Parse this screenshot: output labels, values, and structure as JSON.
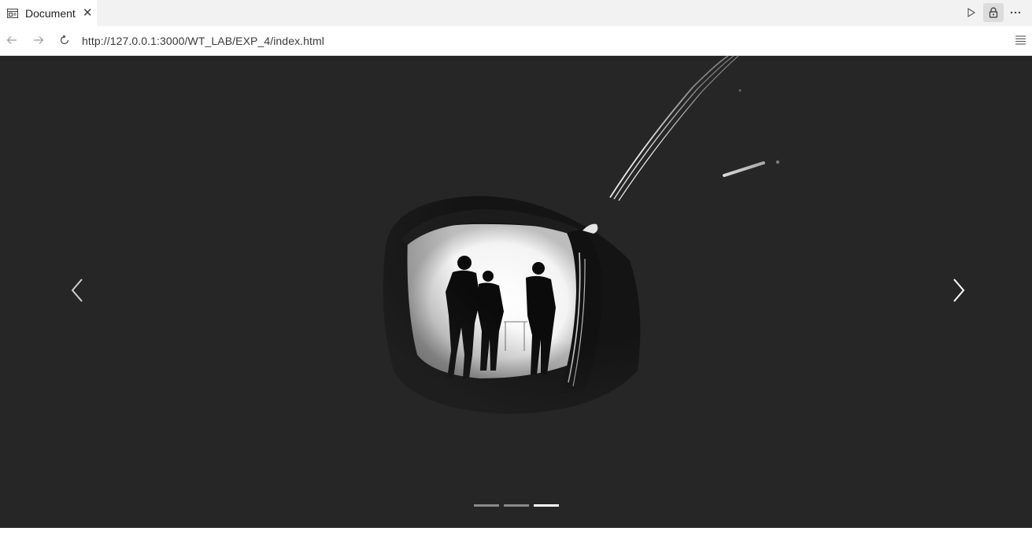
{
  "browser": {
    "tab": {
      "title": "Document",
      "icon": "document-page-icon",
      "close_icon": "close-icon"
    },
    "toolbar_icons": [
      "play-icon",
      "lock-icon",
      "more-icon"
    ],
    "nav": {
      "back_icon": "back-arrow-icon",
      "forward_icon": "forward-arrow-icon",
      "reload_icon": "reload-icon",
      "url": "http://127.0.0.1:3000/WT_LAB/EXP_4/index.html",
      "menu_icon": "menu-lines-icon"
    }
  },
  "carousel": {
    "background": "#262626",
    "image": "silhouettes-in-cave-tunnel-photo",
    "prev_icon": "chevron-left-icon",
    "next_icon": "chevron-right-icon",
    "indicators": [
      {
        "label": "slide 1",
        "active": false
      },
      {
        "label": "slide 2",
        "active": false
      },
      {
        "label": "slide 3",
        "active": true
      }
    ]
  }
}
